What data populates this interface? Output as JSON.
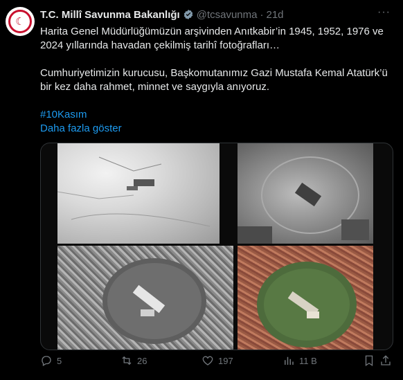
{
  "post": {
    "display_name": "T.C. Millî Savunma Bakanlığı",
    "handle": "@tcsavunma",
    "separator": "·",
    "time": "21d",
    "text_line1": "Harita Genel Müdürlüğümüzün arşivinden Anıtkabir’in 1945, 1952, 1976 ve 2024 yıllarında havadan çekilmiş tarihî fotoğrafları…",
    "text_line2": "Cumhuriyetimizin kurucusu, Başkomutanımız Gazi Mustafa Kemal Atatürk’ü bir kez daha rahmet, minnet ve saygıyla anıyoruz.",
    "hashtag": "#10Kasım",
    "show_more": "Daha fazla göster"
  },
  "actions": {
    "replies": "5",
    "reposts": "26",
    "likes": "197",
    "views": "11 B"
  },
  "colors": {
    "background": "#000000",
    "text": "#e7e9ea",
    "muted": "#71767b",
    "link": "#1d9bf0",
    "verified_badge": "#829aab",
    "logo_red": "#c8102e"
  },
  "icons": [
    "more-icon",
    "verified-icon",
    "reply-icon",
    "repost-icon",
    "like-icon",
    "views-icon",
    "bookmark-icon",
    "share-icon"
  ]
}
